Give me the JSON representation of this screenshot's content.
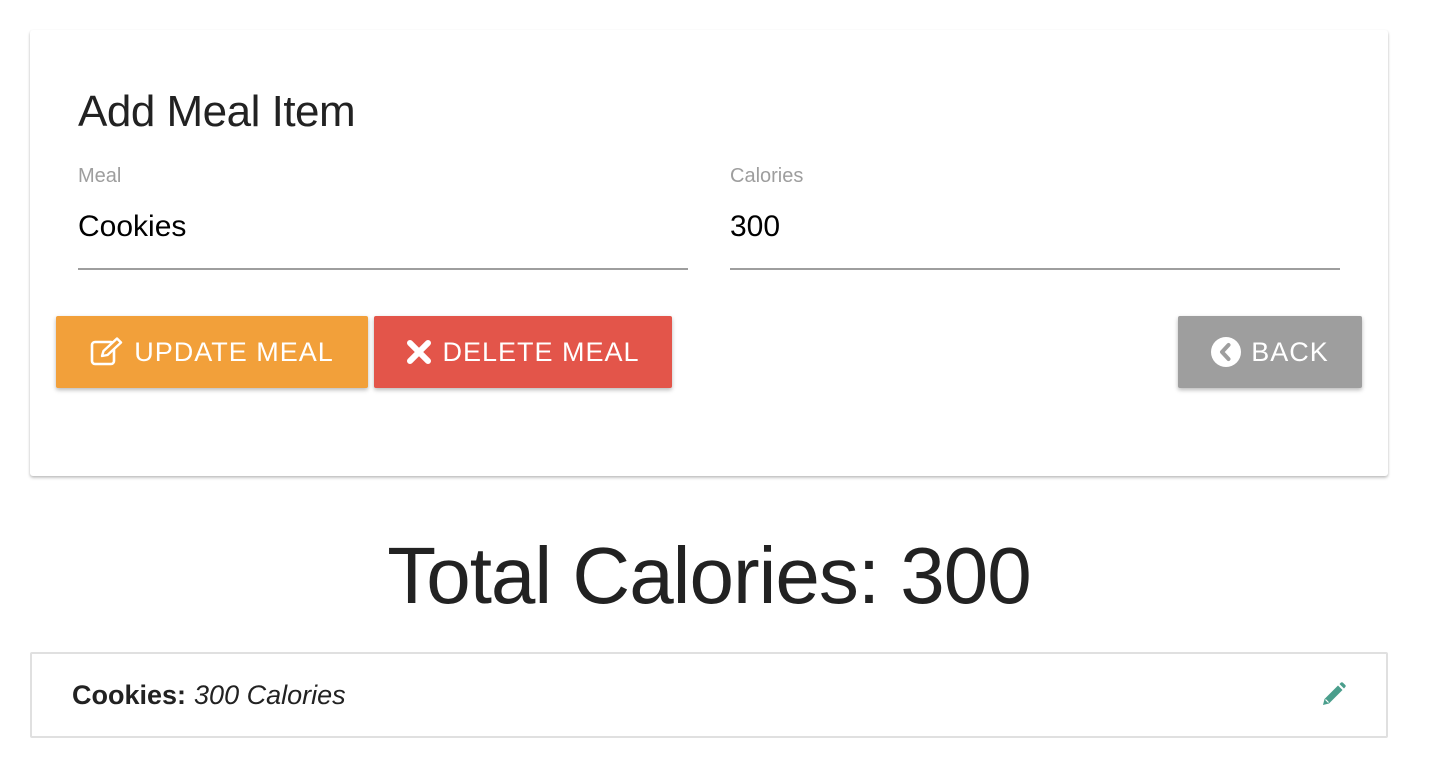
{
  "form": {
    "title": "Add Meal Item",
    "meal_label": "Meal",
    "meal_value": "Cookies",
    "calories_label": "Calories",
    "calories_value": "300",
    "update_label": "UPDATE MEAL",
    "delete_label": "DELETE MEAL",
    "back_label": "BACK"
  },
  "total": {
    "text": "Total Calories: 300"
  },
  "items": [
    {
      "name": "Cookies:",
      "calories": "300 Calories"
    }
  ],
  "icons": {
    "update": "edit-square-icon",
    "delete": "close-icon",
    "back": "chevron-circle-left-icon",
    "item_edit": "pencil-icon"
  },
  "colors": {
    "update": "#f2a03a",
    "delete": "#e3554a",
    "back": "#9e9e9e",
    "edit_icon": "#4a9e8c"
  }
}
